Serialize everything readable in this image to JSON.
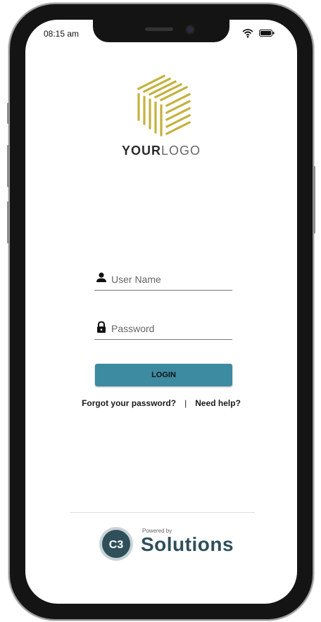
{
  "status_bar": {
    "time": "08:15 am"
  },
  "logo": {
    "word_bold": "YOUR",
    "word_light": "LOGO"
  },
  "login_form": {
    "username_placeholder": "User Name",
    "password_placeholder": "Password",
    "login_label": "LOGIN"
  },
  "links": {
    "forgot_label": "Forgot your password?",
    "separator": "|",
    "help_label": "Need help?"
  },
  "footer": {
    "powered_by": "Powered by",
    "brand_name": "Solutions",
    "badge_glyph": "C3"
  },
  "colors": {
    "accent": "#3c8ba1",
    "logo_gold": "#c4b23e",
    "brand_dark": "#2f4f5a"
  }
}
